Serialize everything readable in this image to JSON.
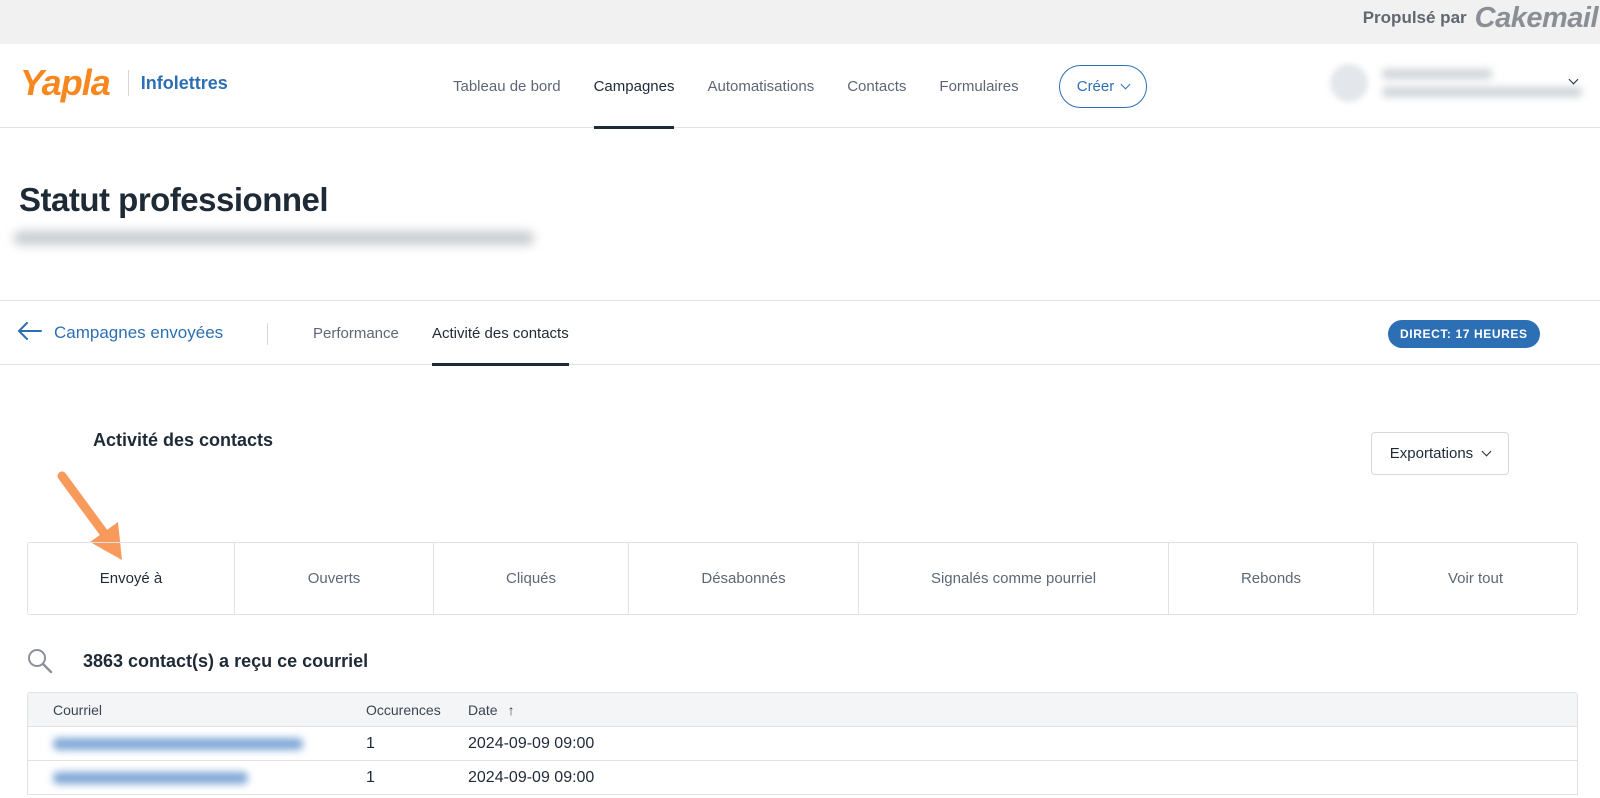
{
  "topbar": {
    "powered_label": "Propulsé par",
    "powered_brand": "Cakemail"
  },
  "brand": {
    "logo": "Yapla",
    "product": "Infolettres"
  },
  "nav": {
    "items": [
      {
        "label": "Tableau de bord",
        "active": false
      },
      {
        "label": "Campagnes",
        "active": true
      },
      {
        "label": "Automatisations",
        "active": false
      },
      {
        "label": "Contacts",
        "active": false
      },
      {
        "label": "Formulaires",
        "active": false
      }
    ],
    "create_label": "Créer"
  },
  "page": {
    "title": "Statut professionnel"
  },
  "subnav": {
    "back_label": "Campagnes envoyées",
    "tabs": [
      {
        "label": "Performance",
        "active": false
      },
      {
        "label": "Activité des contacts",
        "active": true
      }
    ],
    "live_badge": "DIRECT: 17 HEURES"
  },
  "section": {
    "title": "Activité des contacts",
    "export_label": "Exportations"
  },
  "filters": [
    {
      "label": "Envoyé à",
      "active": true
    },
    {
      "label": "Ouverts",
      "active": false
    },
    {
      "label": "Cliqués",
      "active": false
    },
    {
      "label": "Désabonnés",
      "active": false
    },
    {
      "label": "Signalés comme pourriel",
      "active": false
    },
    {
      "label": "Rebonds",
      "active": false
    },
    {
      "label": "Voir tout",
      "active": false
    }
  ],
  "search": {
    "count_text": "3863 contact(s) a reçu ce courriel"
  },
  "table": {
    "columns": {
      "email": "Courriel",
      "occurrences": "Occurences",
      "date": "Date",
      "sort_indicator": "↑"
    },
    "rows": [
      {
        "occurrences": "1",
        "date": "2024-09-09 09:00"
      },
      {
        "occurrences": "1",
        "date": "2024-09-09 09:00"
      }
    ]
  },
  "colors": {
    "accent_blue": "#2d6fb5",
    "brand_orange": "#f7881f",
    "annotation_orange": "#f89a5c"
  },
  "icons": {
    "back": "arrow-left-icon",
    "search": "search-icon",
    "chevron": "chevron-down-icon",
    "annotation": "orange-arrow-annotation"
  }
}
